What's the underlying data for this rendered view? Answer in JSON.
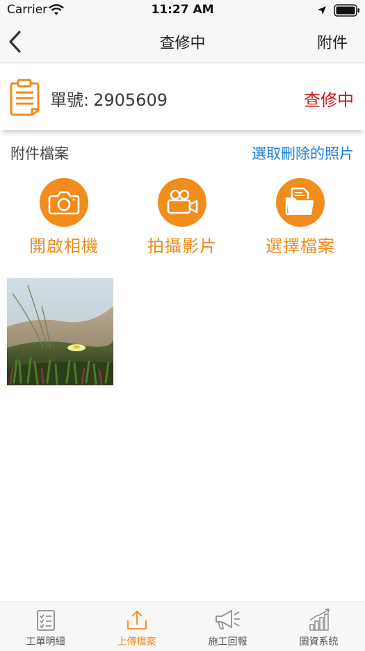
{
  "status_bar": {
    "carrier": "Carrier",
    "time": "11:27 AM"
  },
  "nav": {
    "title": "查修中",
    "right_action": "附件",
    "back_icon": "chevron-left-icon"
  },
  "order": {
    "label": "單號:",
    "number": "2905609",
    "status": "查修中",
    "status_color": "#cc1a1a",
    "icon": "clipboard-document-icon"
  },
  "attachments": {
    "section_title": "附件檔案",
    "select_delete_link": "選取刪除的照片",
    "link_color": "#1a7fd6",
    "actions": [
      {
        "label": "開啟相機",
        "icon": "camera-icon"
      },
      {
        "label": "拍攝影片",
        "icon": "video-camera-icon"
      },
      {
        "label": "選擇檔案",
        "icon": "folder-icon"
      }
    ],
    "accent_color": "#f28c1c"
  },
  "tabs": [
    {
      "label": "工單明細",
      "icon": "checklist-icon",
      "active": false
    },
    {
      "label": "上傳檔案",
      "icon": "upload-icon",
      "active": true
    },
    {
      "label": "施工回報",
      "icon": "megaphone-icon",
      "active": false
    },
    {
      "label": "圖資系統",
      "icon": "bar-chart-icon",
      "active": false
    }
  ]
}
